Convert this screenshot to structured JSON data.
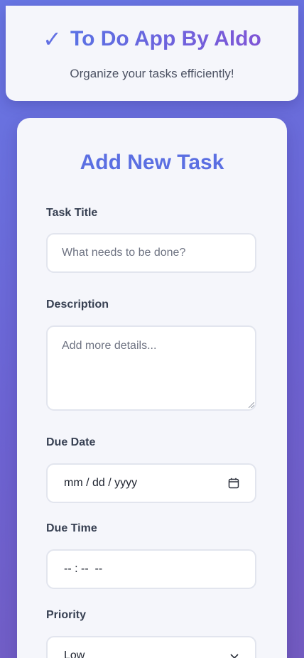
{
  "header": {
    "check_glyph": "✓",
    "title": "To Do App By Aldo",
    "subtitle": "Organize your tasks efficiently!"
  },
  "form": {
    "title": "Add New Task",
    "task_title": {
      "label": "Task Title",
      "placeholder": "What needs to be done?",
      "value": ""
    },
    "description": {
      "label": "Description",
      "placeholder": "Add more details...",
      "value": ""
    },
    "due_date": {
      "label": "Due Date",
      "display": "mm / dd / yyyy",
      "icon": "calendar-icon"
    },
    "due_time": {
      "label": "Due Time",
      "display": "-- : --  --"
    },
    "priority": {
      "label": "Priority",
      "selected": "Low",
      "icon": "chevron-down-icon"
    }
  },
  "colors": {
    "background_start": "#6877e4",
    "background_end": "#735bc0",
    "accent": "#5b6fe2",
    "card": "#f5f6fb"
  }
}
